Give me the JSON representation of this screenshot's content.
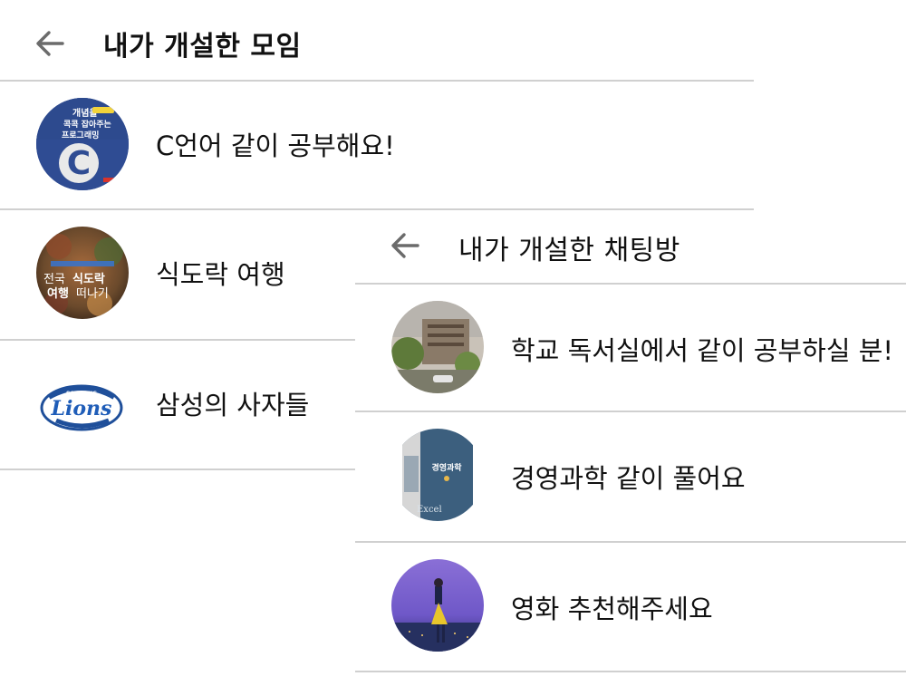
{
  "screen_a": {
    "title": "내가 개설한 모임",
    "items": [
      {
        "label": "C언어 같이 공부해요!",
        "thumb_caption": "개념을 콕콕 잡아주는 프로그래밍",
        "thumb_letter": "C"
      },
      {
        "label": "식도락 여행",
        "thumb_caption_top": "전국",
        "thumb_caption_bold": "식도락",
        "thumb_caption_bottom": "여행떠나기"
      },
      {
        "label": "삼성의 사자들",
        "thumb_caption": "Lions"
      }
    ]
  },
  "screen_b": {
    "title": "내가 개설한 채팅방",
    "items": [
      {
        "label": "학교 독서실에서 같이 공부하실 분!"
      },
      {
        "label": "경영과학 같이 풀어요",
        "thumb_caption": "경영과학",
        "thumb_caption_bottom": "Excel"
      },
      {
        "label": "영화 추천해주세요"
      }
    ]
  },
  "colors": {
    "divider": "#d0d0d0",
    "back_icon": "#6b6b6b",
    "text": "#111111"
  }
}
